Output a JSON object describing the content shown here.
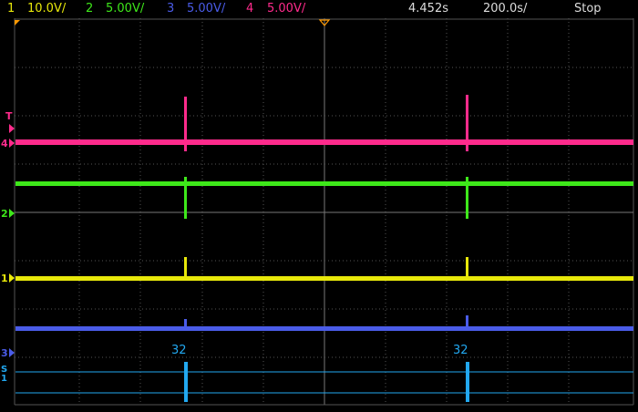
{
  "colors": {
    "ch1": "#e8e80a",
    "ch2": "#3ee81a",
    "ch3": "#4a5ce8",
    "ch4": "#ff2b8c",
    "bus": "#22a8f0",
    "grid": "#555555",
    "trigger": "#ff9900"
  },
  "status_bar": {
    "ch1": {
      "number": "1",
      "scale": "10.0V/"
    },
    "ch2": {
      "number": "2",
      "scale": "5.00V/"
    },
    "ch3": {
      "number": "3",
      "scale": "5.00V/"
    },
    "ch4": {
      "number": "4",
      "scale": "5.00V/"
    },
    "delay": "4.452s",
    "timebase": "200.0s/",
    "run_state": "Stop"
  },
  "markers": {
    "trigger_label": "T",
    "ch4": "4",
    "ch2": "2",
    "ch1": "1",
    "ch3": "3",
    "bus": "S1"
  },
  "bus_decode": {
    "packets": [
      {
        "value": "32"
      },
      {
        "value": "32"
      }
    ]
  }
}
